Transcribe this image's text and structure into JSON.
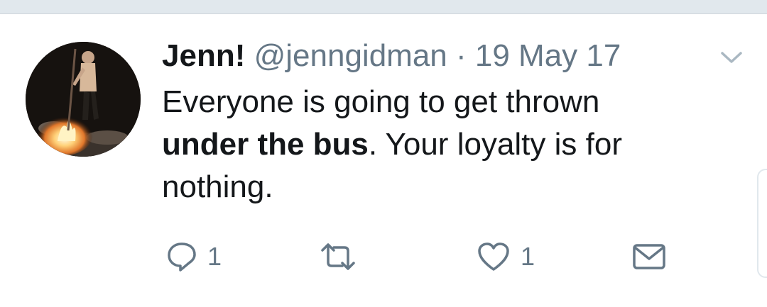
{
  "tweet": {
    "author": {
      "display_name": "Jenn!",
      "handle": "@jenngidman"
    },
    "separator": "·",
    "date": "19 May 17",
    "text_parts": {
      "line1": "Everyone is going to get thrown",
      "bold": "under the bus",
      "rest": ". Your loyalty is for nothing."
    },
    "actions": {
      "reply_count": "1",
      "retweet_count": "",
      "like_count": "1"
    }
  },
  "colors": {
    "text_primary": "#14171a",
    "text_secondary": "#657786",
    "divider": "#e1e8ed"
  },
  "icons": [
    "chevron-down-icon",
    "reply-icon",
    "retweet-icon",
    "heart-icon",
    "envelope-icon"
  ]
}
